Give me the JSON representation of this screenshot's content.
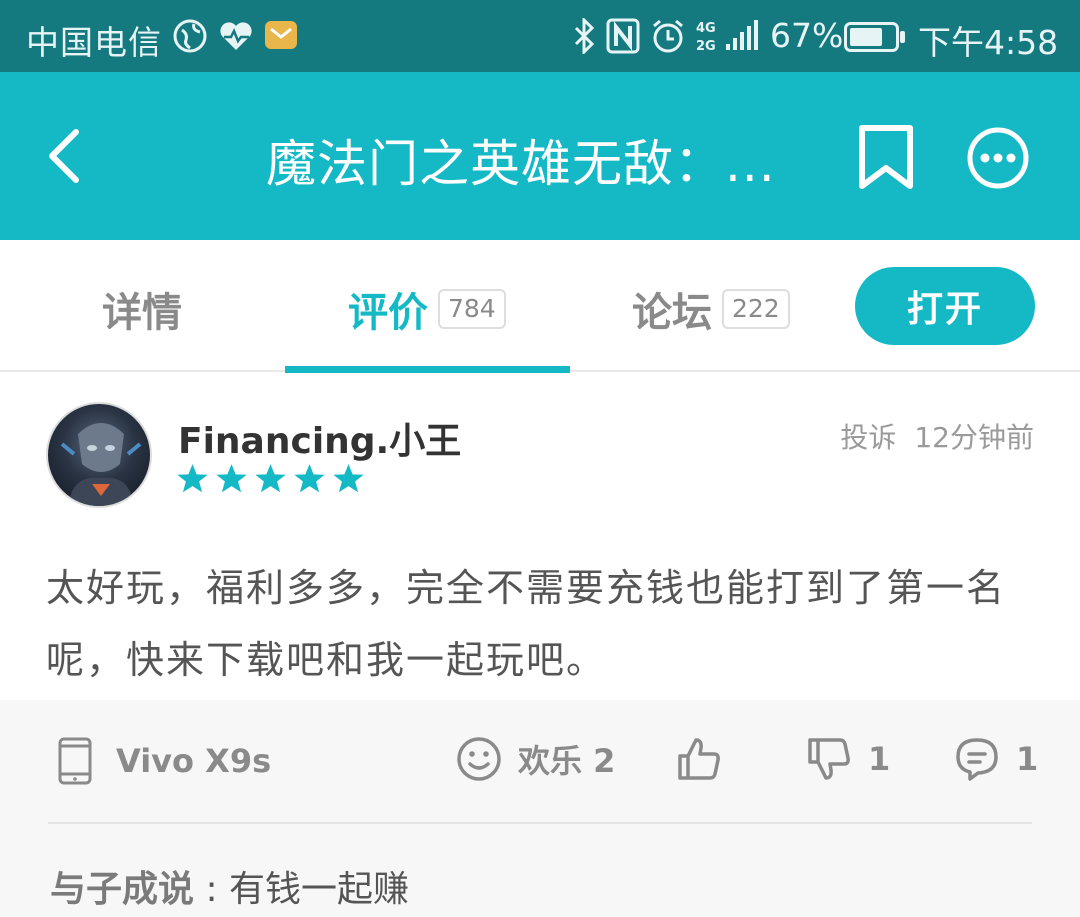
{
  "status_bar": {
    "carrier": "中国电信",
    "battery_percent": "67%",
    "time": "下午4:58",
    "network": "4G 2G"
  },
  "header": {
    "title": "魔法门之英雄无敌：...",
    "colors": {
      "primary": "#15b9c6",
      "status_bar": "#157a80"
    }
  },
  "tabs": [
    {
      "label": "详情"
    },
    {
      "label": "评价",
      "count": "784",
      "active": true
    },
    {
      "label": "论坛",
      "count": "222"
    }
  ],
  "open_button": {
    "label": "打开"
  },
  "review": {
    "username": "Financing.小王",
    "rating": 5,
    "report_label": "投诉",
    "timestamp": "12分钟前",
    "text": "太好玩，福利多多，完全不需要充钱也能打到了第一名呢，快来下载吧和我一起玩吧。",
    "device": "Vivo X9s",
    "fun_label": "欢乐 2",
    "dislike_count": "1",
    "comment_count": "1",
    "reply": {
      "user": "与子成说",
      "separator": " : ",
      "text": "有钱一起赚"
    }
  }
}
